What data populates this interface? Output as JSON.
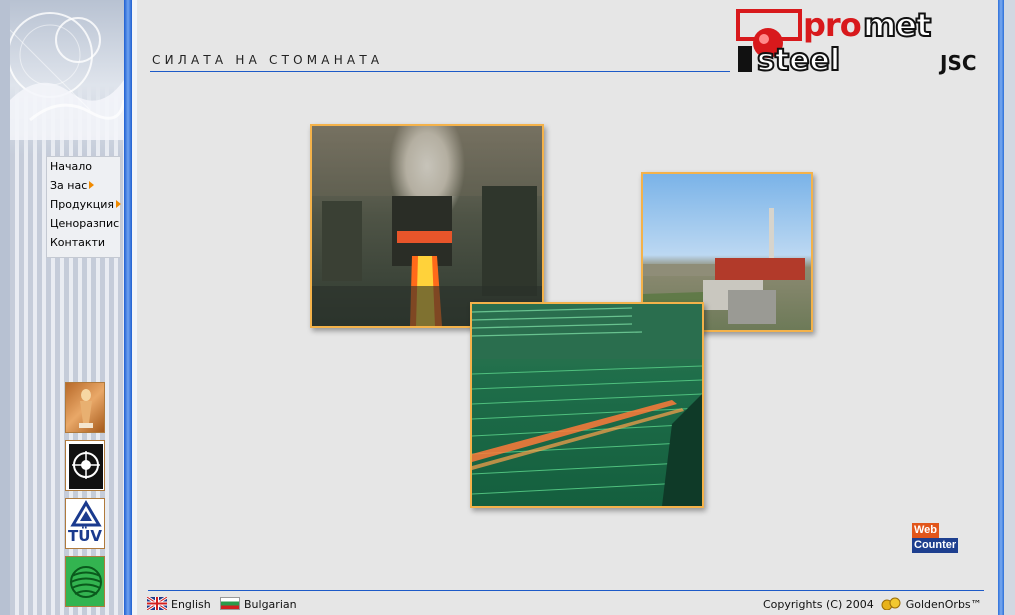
{
  "header": {
    "tagline": "СИЛАТА НА СТОМАНАТА",
    "logo": {
      "line1_red": "pro",
      "line1_black": "met",
      "line2": "steel",
      "suffix": "JSC"
    }
  },
  "sidebar": {
    "nav": [
      {
        "label": "Начало",
        "has_submenu": false
      },
      {
        "label": "За нас",
        "has_submenu": true
      },
      {
        "label": "Продукция",
        "has_submenu": true
      },
      {
        "label": "Ценоразпис",
        "has_submenu": false
      },
      {
        "label": "Контакти",
        "has_submenu": false
      }
    ],
    "badges": {
      "tuv": "TÜV"
    }
  },
  "gallery": {
    "photos": [
      "steel-mill-hot-rolling-icon",
      "plant-exterior-chimney-icon",
      "cooling-bed-rebar-icon"
    ]
  },
  "webcounter": {
    "part1": "Web",
    "part2": "Counter"
  },
  "footer": {
    "lang_english": "English",
    "lang_bulgarian": "Bulgarian",
    "copyright": "Copyrights (C) 2004",
    "credit": "GoldenOrbs™"
  },
  "colors": {
    "accent_blue": "#1d5ac8",
    "photo_border": "#f4b24a",
    "logo_red": "#d8191c",
    "nav_arrow": "#f08a00"
  }
}
